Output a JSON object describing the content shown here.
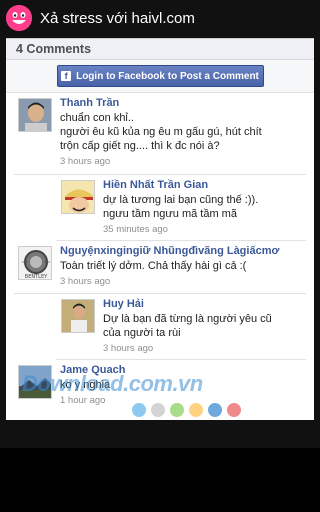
{
  "app": {
    "title": "Xả stress với haivl.com",
    "logo_icon": "smiley-face-icon",
    "accent": "#ff3d8b"
  },
  "comments_header": "4 Comments",
  "login_button_label": "Login to Facebook to Post a Comment",
  "comments": [
    {
      "author": "Thanh Trần",
      "text_lines": [
        "chuẩn con khỉ..",
        "người êu kũ kủa ng êu m gấu gú, hút chít",
        "trộn cấp giết ng.... thì k đc nói à?"
      ],
      "time": "3 hours ago",
      "avatar": "person-photo"
    },
    {
      "author": "Hiền Nhất Trần Gian",
      "text_lines": [
        "dự là tương lai bạn cũng thế :)).",
        "ngưu tầm ngưu mã tầm mã"
      ],
      "time": "35 minutes ago",
      "avatar": "luffy-cartoon"
    },
    {
      "author": "Nguyệnxingingiữ Nhũngđìvãng Làgiấcmơ",
      "text_lines": [
        "Toàn triết lý dởm. Chả thấy hài gì cả :("
      ],
      "time": "3 hours ago",
      "avatar": "bentley-logo"
    },
    {
      "author": "Huy Hải",
      "text_lines": [
        "Dự là bạn đã từng là người yêu cũ",
        "của người ta rùi"
      ],
      "time": "3 hours ago",
      "avatar": "person-photo"
    },
    {
      "author": "Jame Quach",
      "text_lines": [
        "ko y nghia"
      ],
      "time": "1 hour ago",
      "avatar": "landscape-photo"
    }
  ],
  "watermark": "Download.com.vn",
  "colors": {
    "fb_blue": "#3b5998",
    "dot_colors": [
      "#8fc9f0",
      "#d4d4d4",
      "#a9dc8a",
      "#ffd27f",
      "#6fa8dc",
      "#f08a8a"
    ]
  }
}
